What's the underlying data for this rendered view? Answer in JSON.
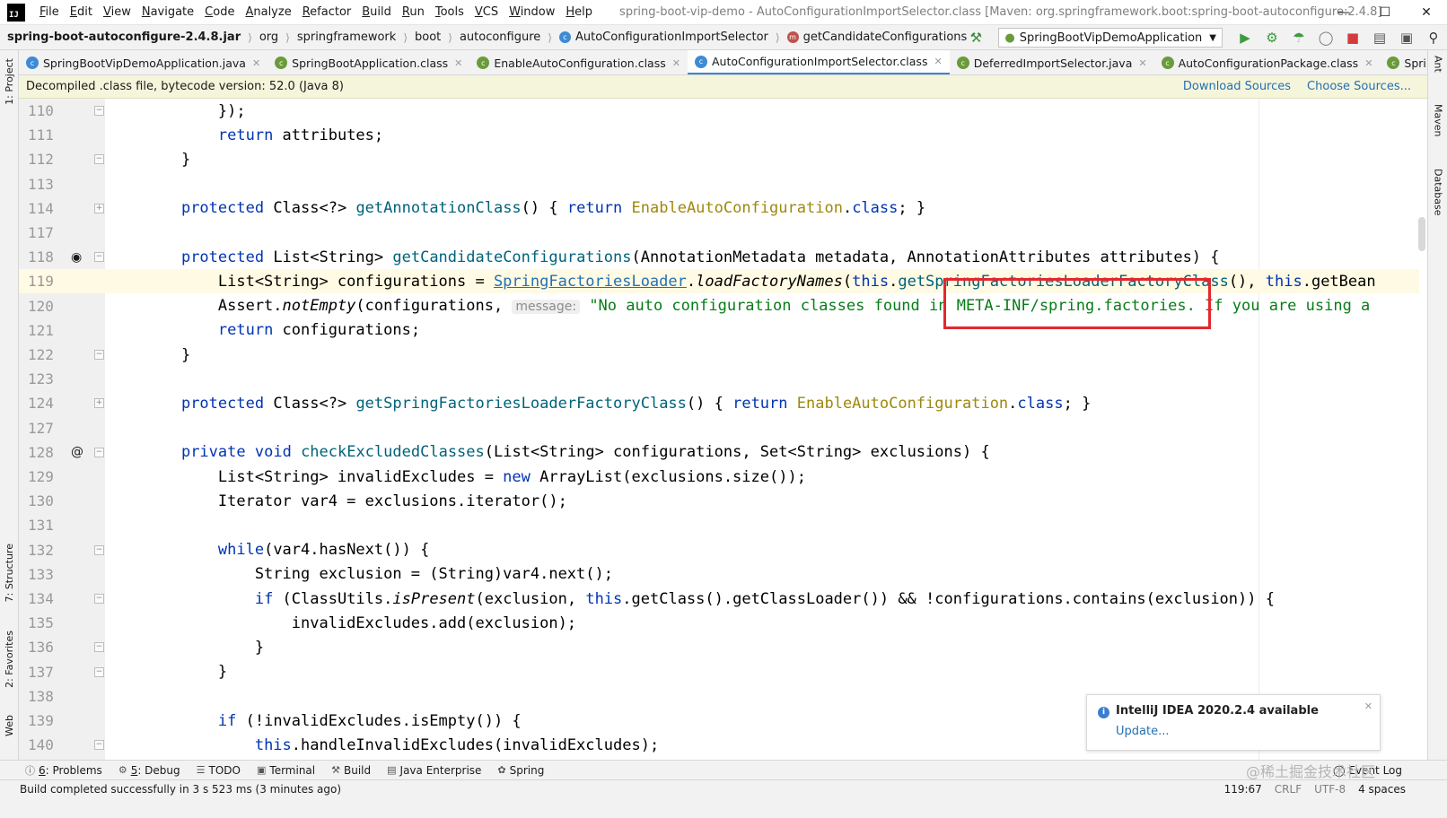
{
  "menu": {
    "items": [
      {
        "label": "File",
        "mnemonic": "F",
        "rest": "ile"
      },
      {
        "label": "Edit",
        "mnemonic": "E",
        "rest": "dit"
      },
      {
        "label": "View",
        "mnemonic": "V",
        "rest": "iew"
      },
      {
        "label": "Navigate",
        "mnemonic": "N",
        "rest": "avigate"
      },
      {
        "label": "Code",
        "mnemonic": "C",
        "rest": "ode"
      },
      {
        "label": "Analyze",
        "mnemonic": "A",
        "rest": "nalyze"
      },
      {
        "label": "Refactor",
        "mnemonic": "R",
        "rest": "efactor"
      },
      {
        "label": "Build",
        "mnemonic": "B",
        "rest": "uild"
      },
      {
        "label": "Run",
        "mnemonic": "R",
        "rest": "un"
      },
      {
        "label": "Tools",
        "mnemonic": "T",
        "rest": "ools"
      },
      {
        "label": "VCS",
        "mnemonic": "V",
        "rest": "CS"
      },
      {
        "label": "Window",
        "mnemonic": "W",
        "rest": "indow"
      },
      {
        "label": "Help",
        "mnemonic": "H",
        "rest": "elp"
      }
    ],
    "window_title": "spring-boot-vip-demo - AutoConfigurationImportSelector.class [Maven: org.springframework.boot:spring-boot-autoconfigure:2.4.8]"
  },
  "breadcrumb": {
    "items": [
      "spring-boot-autoconfigure-2.4.8.jar",
      "org",
      "springframework",
      "boot",
      "autoconfigure",
      "AutoConfigurationImportSelector",
      "getCandidateConfigurations"
    ]
  },
  "run_config": {
    "label": "SpringBootVipDemoApplication"
  },
  "tabs": [
    {
      "label": "SpringBootVipDemoApplication.java",
      "icon_color": "#3d8bd4",
      "active": false
    },
    {
      "label": "SpringBootApplication.class",
      "icon_color": "#6a9b3a",
      "active": false
    },
    {
      "label": "EnableAutoConfiguration.class",
      "icon_color": "#6a9b3a",
      "active": false
    },
    {
      "label": "AutoConfigurationImportSelector.class",
      "icon_color": "#3d8bd4",
      "active": true
    },
    {
      "label": "DeferredImportSelector.java",
      "icon_color": "#6a9b3a",
      "active": false
    },
    {
      "label": "AutoConfigurationPackage.class",
      "icon_color": "#6a9b3a",
      "active": false
    },
    {
      "label": "SpringBootCon",
      "icon_color": "#6a9b3a",
      "active": false
    }
  ],
  "banner": {
    "message": "Decompiled .class file, bytecode version: 52.0 (Java 8)",
    "download_sources": "Download Sources",
    "choose_sources": "Choose Sources..."
  },
  "editor": {
    "hint_message": "message:",
    "lines": [
      {
        "n": "110",
        "text": "        });"
      },
      {
        "n": "111",
        "text": "        return attributes;"
      },
      {
        "n": "112",
        "text": "    }"
      },
      {
        "n": "113",
        "text": ""
      },
      {
        "n": "114",
        "text": "    protected Class<?> getAnnotationClass() { return EnableAutoConfiguration.class; }"
      },
      {
        "n": "117",
        "text": ""
      },
      {
        "n": "118",
        "text": "    protected List<String> getCandidateConfigurations(AnnotationMetadata metadata, AnnotationAttributes attributes) {"
      },
      {
        "n": "119",
        "text": "        List<String> configurations = SpringFactoriesLoader.loadFactoryNames(this.getSpringFactoriesLoaderFactoryClass(), this.getBean"
      },
      {
        "n": "120",
        "text": "        Assert.notEmpty(configurations, \"No auto configuration classes found in META-INF/spring.factories. If you are using a"
      },
      {
        "n": "121",
        "text": "        return configurations;"
      },
      {
        "n": "122",
        "text": "    }"
      },
      {
        "n": "123",
        "text": ""
      },
      {
        "n": "124",
        "text": "    protected Class<?> getSpringFactoriesLoaderFactoryClass() { return EnableAutoConfiguration.class; }"
      },
      {
        "n": "127",
        "text": ""
      },
      {
        "n": "128",
        "text": "    private void checkExcludedClasses(List<String> configurations, Set<String> exclusions) {"
      },
      {
        "n": "129",
        "text": "        List<String> invalidExcludes = new ArrayList(exclusions.size());"
      },
      {
        "n": "130",
        "text": "        Iterator var4 = exclusions.iterator();"
      },
      {
        "n": "131",
        "text": ""
      },
      {
        "n": "132",
        "text": "        while(var4.hasNext()) {"
      },
      {
        "n": "133",
        "text": "            String exclusion = (String)var4.next();"
      },
      {
        "n": "134",
        "text": "            if (ClassUtils.isPresent(exclusion, this.getClass().getClassLoader()) && !configurations.contains(exclusion)) {"
      },
      {
        "n": "135",
        "text": "                invalidExcludes.add(exclusion);"
      },
      {
        "n": "136",
        "text": "            }"
      },
      {
        "n": "137",
        "text": "        }"
      },
      {
        "n": "138",
        "text": ""
      },
      {
        "n": "139",
        "text": "        if (!invalidExcludes.isEmpty()) {"
      },
      {
        "n": "140",
        "text": "            this.handleInvalidExcludes(invalidExcludes);"
      }
    ]
  },
  "notification": {
    "title": "IntelliJ IDEA 2020.2.4 available",
    "link": "Update..."
  },
  "tool_windows": [
    {
      "prefix": "6",
      "label": ": Problems",
      "icon": "info-icon"
    },
    {
      "prefix": "5",
      "label": ": Debug",
      "icon": "bug-icon"
    },
    {
      "prefix": "",
      "label": "TODO",
      "icon": "list-icon"
    },
    {
      "prefix": "",
      "label": "Terminal",
      "icon": "terminal-icon"
    },
    {
      "prefix": "",
      "label": "Build",
      "icon": "hammer-icon"
    },
    {
      "prefix": "",
      "label": "Java Enterprise",
      "icon": "java-ee-icon"
    },
    {
      "prefix": "",
      "label": "Spring",
      "icon": "spring-icon"
    }
  ],
  "event_log": "Event Log",
  "left_strip": [
    "1: Project",
    "7: Structure",
    "2: Favorites",
    "Web"
  ],
  "right_strip": [
    "Ant",
    "Maven",
    "Database"
  ],
  "status": {
    "message": "Build completed successfully in 3 s 523 ms (3 minutes ago)",
    "position": "119:67",
    "line_sep": "CRLF",
    "encoding": "UTF-8",
    "indent": "4 spaces"
  },
  "watermark": "@稀土掘金技术社区",
  "colors": {
    "accent": "#4083c9",
    "highlight_box": "#e2282e",
    "keyword": "#0033b3",
    "string": "#067d17",
    "method": "#00627a"
  }
}
